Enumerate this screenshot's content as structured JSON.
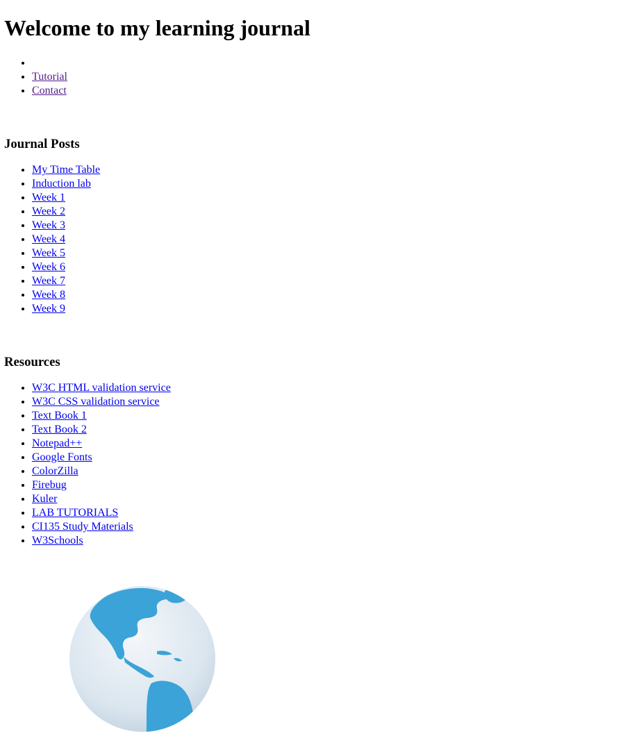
{
  "header": {
    "title": "Welcome to my learning journal"
  },
  "nav": {
    "items": [
      {
        "label": ""
      },
      {
        "label": "Tutorial"
      },
      {
        "label": "Contact"
      }
    ]
  },
  "posts": {
    "heading": "Journal Posts",
    "items": [
      {
        "label": "My Time Table"
      },
      {
        "label": "Induction lab"
      },
      {
        "label": "Week 1"
      },
      {
        "label": "Week 2"
      },
      {
        "label": "Week 3"
      },
      {
        "label": "Week 4"
      },
      {
        "label": "Week 5"
      },
      {
        "label": "Week 6"
      },
      {
        "label": "Week 7"
      },
      {
        "label": "Week 8"
      },
      {
        "label": "Week 9"
      }
    ]
  },
  "resources": {
    "heading": "Resources",
    "items": [
      {
        "label": "W3C HTML validation service"
      },
      {
        "label": "W3C CSS validation service"
      },
      {
        "label": "Text Book 1"
      },
      {
        "label": "Text Book 2"
      },
      {
        "label": "Notepad++"
      },
      {
        "label": "Google Fonts"
      },
      {
        "label": "ColorZilla"
      },
      {
        "label": "Firebug"
      },
      {
        "label": "Kuler"
      },
      {
        "label": "LAB TUTORIALS"
      },
      {
        "label": "CI135 Study Materials"
      },
      {
        "label": "W3Schools"
      }
    ]
  },
  "colors": {
    "link": "#0000ee",
    "visited_link": "#551a8b",
    "globe_land": "#3ba3d8",
    "globe_ocean": "#dbe6ef"
  },
  "image": {
    "icon": "globe-icon"
  }
}
